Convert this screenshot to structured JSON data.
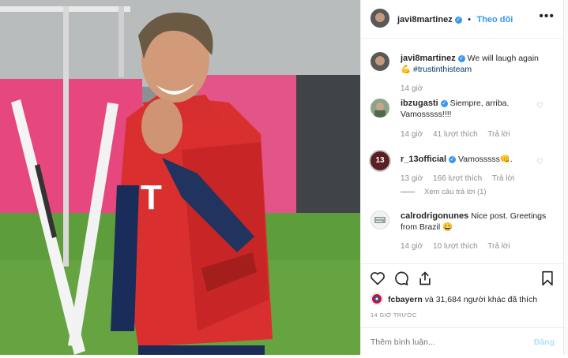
{
  "post_image": {
    "jersey_mark": "T"
  },
  "header": {
    "username": "javi8martinez",
    "follow_label": "Theo dõi",
    "more": "•••"
  },
  "caption": {
    "username": "javi8martinez",
    "text": "We will laugh again ",
    "emoji": "💪",
    "hashtag": "#trustinthisteam",
    "time": "14 giờ"
  },
  "comments": [
    {
      "username": "ibzugasti",
      "verified": true,
      "text": "Siempre, arriba. Vamosssss!!!!",
      "time": "14 giờ",
      "likes": "41 lượt thích",
      "reply": "Trả lời"
    },
    {
      "username": "r_13official",
      "verified": true,
      "text": "Vamosssss👊.",
      "time": "13 giờ",
      "likes": "166 lượt thích",
      "reply": "Trả lời",
      "view_replies": "Xem câu trả lời (1)",
      "avatar_text": "13"
    },
    {
      "username": "calrodrigonunes",
      "verified": false,
      "text": "Nice post. Greetings from Brazil 😀",
      "time": "14 giờ",
      "likes": "10 lượt thích",
      "reply": "Trả lời"
    }
  ],
  "likes": {
    "username": "fcbayern",
    "text": " và 31,684 người khác đã thích"
  },
  "timestamp": "14 GIỜ TRƯỚC",
  "add_comment": {
    "placeholder": "Thêm bình luận...",
    "post_label": "Đăng"
  }
}
